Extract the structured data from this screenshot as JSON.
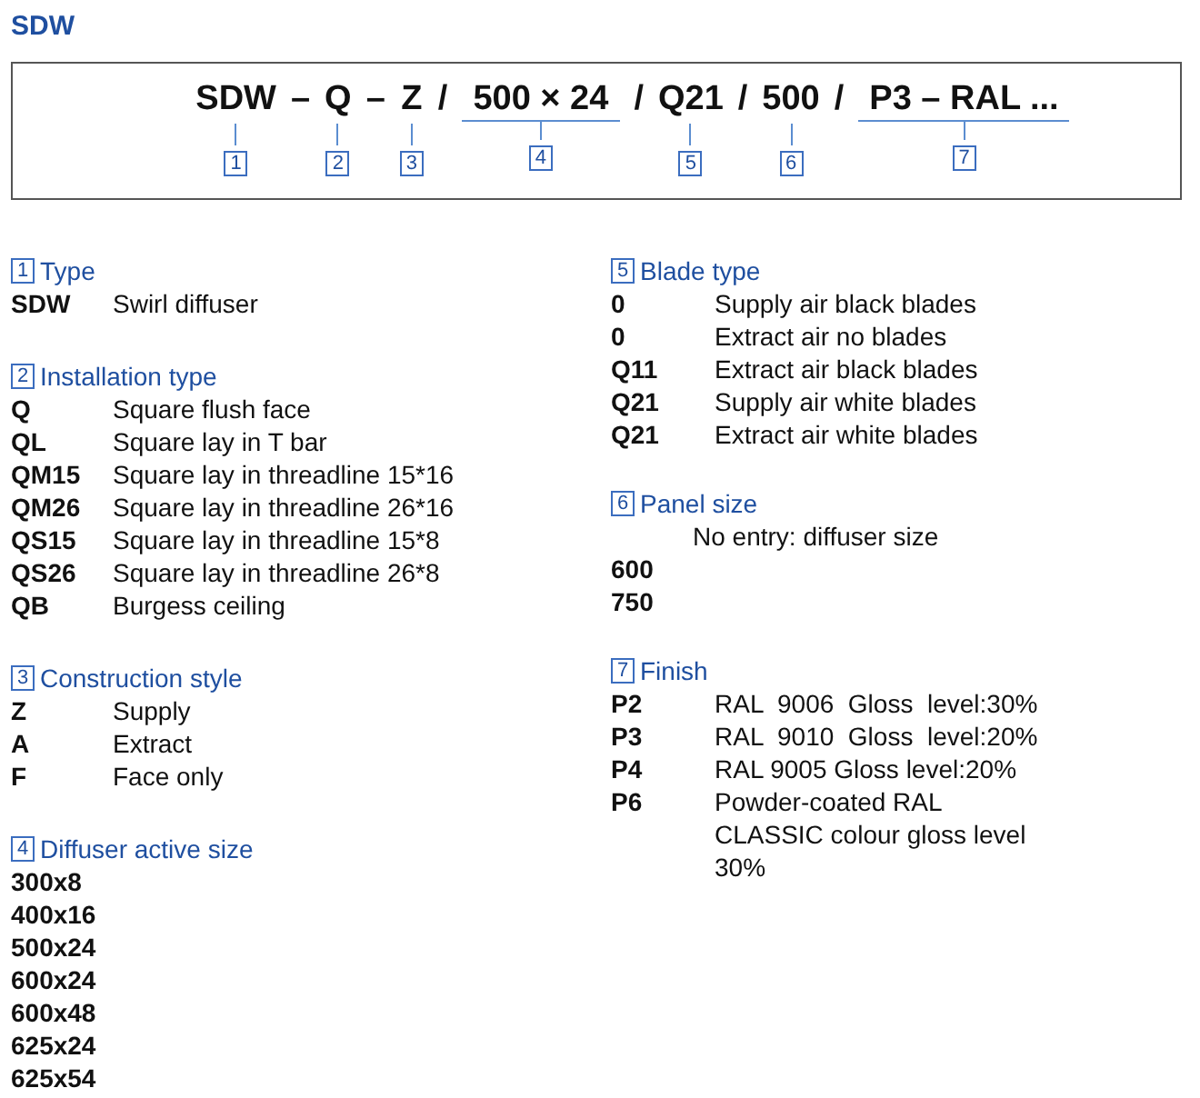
{
  "title": "SDW",
  "code": [
    {
      "text": "SDW",
      "marker": "1",
      "span": false
    },
    {
      "text": "–"
    },
    {
      "text": "Q",
      "marker": "2",
      "span": false
    },
    {
      "text": "–"
    },
    {
      "text": "Z",
      "marker": "3",
      "span": false
    },
    {
      "text": "/"
    },
    {
      "text": "500 × 24",
      "marker": "4",
      "span": true
    },
    {
      "text": "/"
    },
    {
      "text": "Q21",
      "marker": "5",
      "span": false
    },
    {
      "text": "/"
    },
    {
      "text": "500",
      "marker": "6",
      "span": false
    },
    {
      "text": "/"
    },
    {
      "text": "P3 – RAL ...",
      "marker": "7",
      "span": true
    }
  ],
  "columns": [
    [
      {
        "marker": "1",
        "heading": "Type",
        "items": [
          {
            "code": "SDW",
            "description": "Swirl diffuser"
          }
        ]
      },
      {
        "marker": "2",
        "heading": "Installation type",
        "items": [
          {
            "code": "Q",
            "description": "Square flush face"
          },
          {
            "code": "QL",
            "description": "Square lay in T bar"
          },
          {
            "code": "QM15",
            "description": "Square lay in threadline 15*16"
          },
          {
            "code": "QM26",
            "description": "Square lay in threadline 26*16"
          },
          {
            "code": "QS15",
            "description": "Square lay in threadline 15*8"
          },
          {
            "code": "QS26",
            "description": "Square lay in threadline 26*8"
          },
          {
            "code": "QB",
            "description": "Burgess ceiling"
          }
        ]
      },
      {
        "marker": "3",
        "heading": "Construction style",
        "items": [
          {
            "code": "Z",
            "description": "Supply"
          },
          {
            "code": "A",
            "description": "Extract"
          },
          {
            "code": "F",
            "description": "Face only"
          }
        ]
      },
      {
        "marker": "4",
        "heading": "Diffuser active size",
        "items": [
          {
            "code": "300x8"
          },
          {
            "code": "400x16"
          },
          {
            "code": "500x24"
          },
          {
            "code": "600x24"
          },
          {
            "code": "600x48"
          },
          {
            "code": "625x24"
          },
          {
            "code": "625x54"
          }
        ]
      }
    ],
    [
      {
        "marker": "5",
        "heading": "Blade type",
        "items": [
          {
            "code": "0",
            "description": "Supply air black blades"
          },
          {
            "code": "0",
            "description": "Extract air no blades"
          },
          {
            "code": "Q11",
            "description": "Extract air black blades"
          },
          {
            "code": "Q21",
            "description": "Supply air white blades"
          },
          {
            "code": "Q21",
            "description": "Extract air white blades"
          }
        ]
      },
      {
        "marker": "6",
        "heading": "Panel size",
        "items": [
          {
            "note": "No entry: diffuser size"
          },
          {
            "code": "600"
          },
          {
            "code": "750"
          }
        ]
      },
      {
        "marker": "7",
        "heading": "Finish",
        "items": [
          {
            "code": "P2",
            "description": "RAL  9006  Gloss  level:30%"
          },
          {
            "code": "P3",
            "description": "RAL  9010  Gloss  level:20%"
          },
          {
            "code": "P4",
            "description": "RAL 9005 Gloss level:20%"
          },
          {
            "code": "P6",
            "description": "Powder-coated RAL CLASSIC colour gloss level 30%"
          }
        ]
      }
    ]
  ]
}
